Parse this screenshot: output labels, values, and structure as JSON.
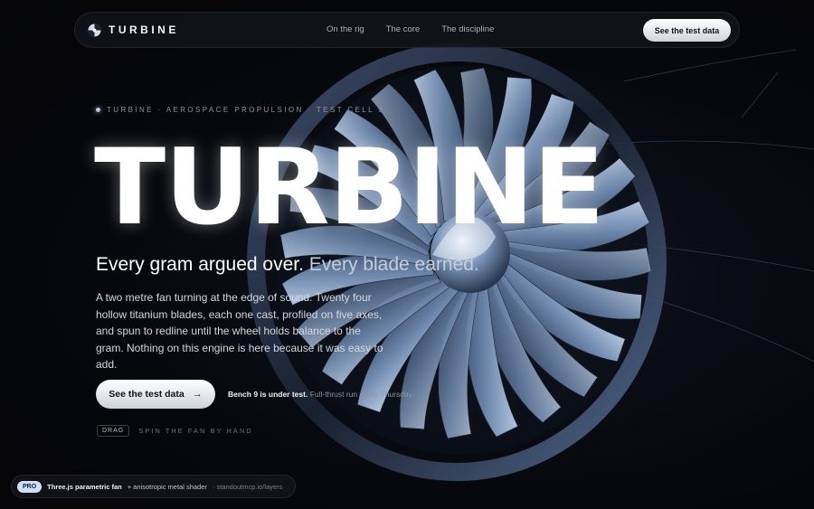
{
  "nav": {
    "brand": "TURBINE",
    "links": [
      "On the rig",
      "The core",
      "The discipline"
    ],
    "cta": "See the test data"
  },
  "hero": {
    "eyebrow": "TURBINE · AEROSPACE PROPULSION · TEST CELL 9",
    "title": "TURBINE",
    "subhead_main": "Every gram argued over.",
    "subhead_muted": "Every blade earned.",
    "body": "A two metre fan turning at the edge of sound. Twenty four hollow titanium blades, each one cast, profiled on five axes, and spun to redline until the wheel holds balance to the gram. Nothing on this engine is here because it was easy to add.",
    "cta": "See the test data",
    "cta_icon": "arrow-right-icon",
    "bench_strong": "Bench 9 is under test.",
    "bench_muted": "Full-thrust run every Thursday.",
    "drag_badge": "DRAG",
    "drag_text": "SPIN THE FAN BY HAND"
  },
  "footer": {
    "badge": "PRO",
    "strong": "Three.js parametric fan",
    "mid": "+ anisotropic metal shader",
    "muted": "· standoutmcp.io/layers"
  },
  "colors": {
    "background": "#060608",
    "blade": "#9fb6d8",
    "accent": "#cfe0f7"
  }
}
